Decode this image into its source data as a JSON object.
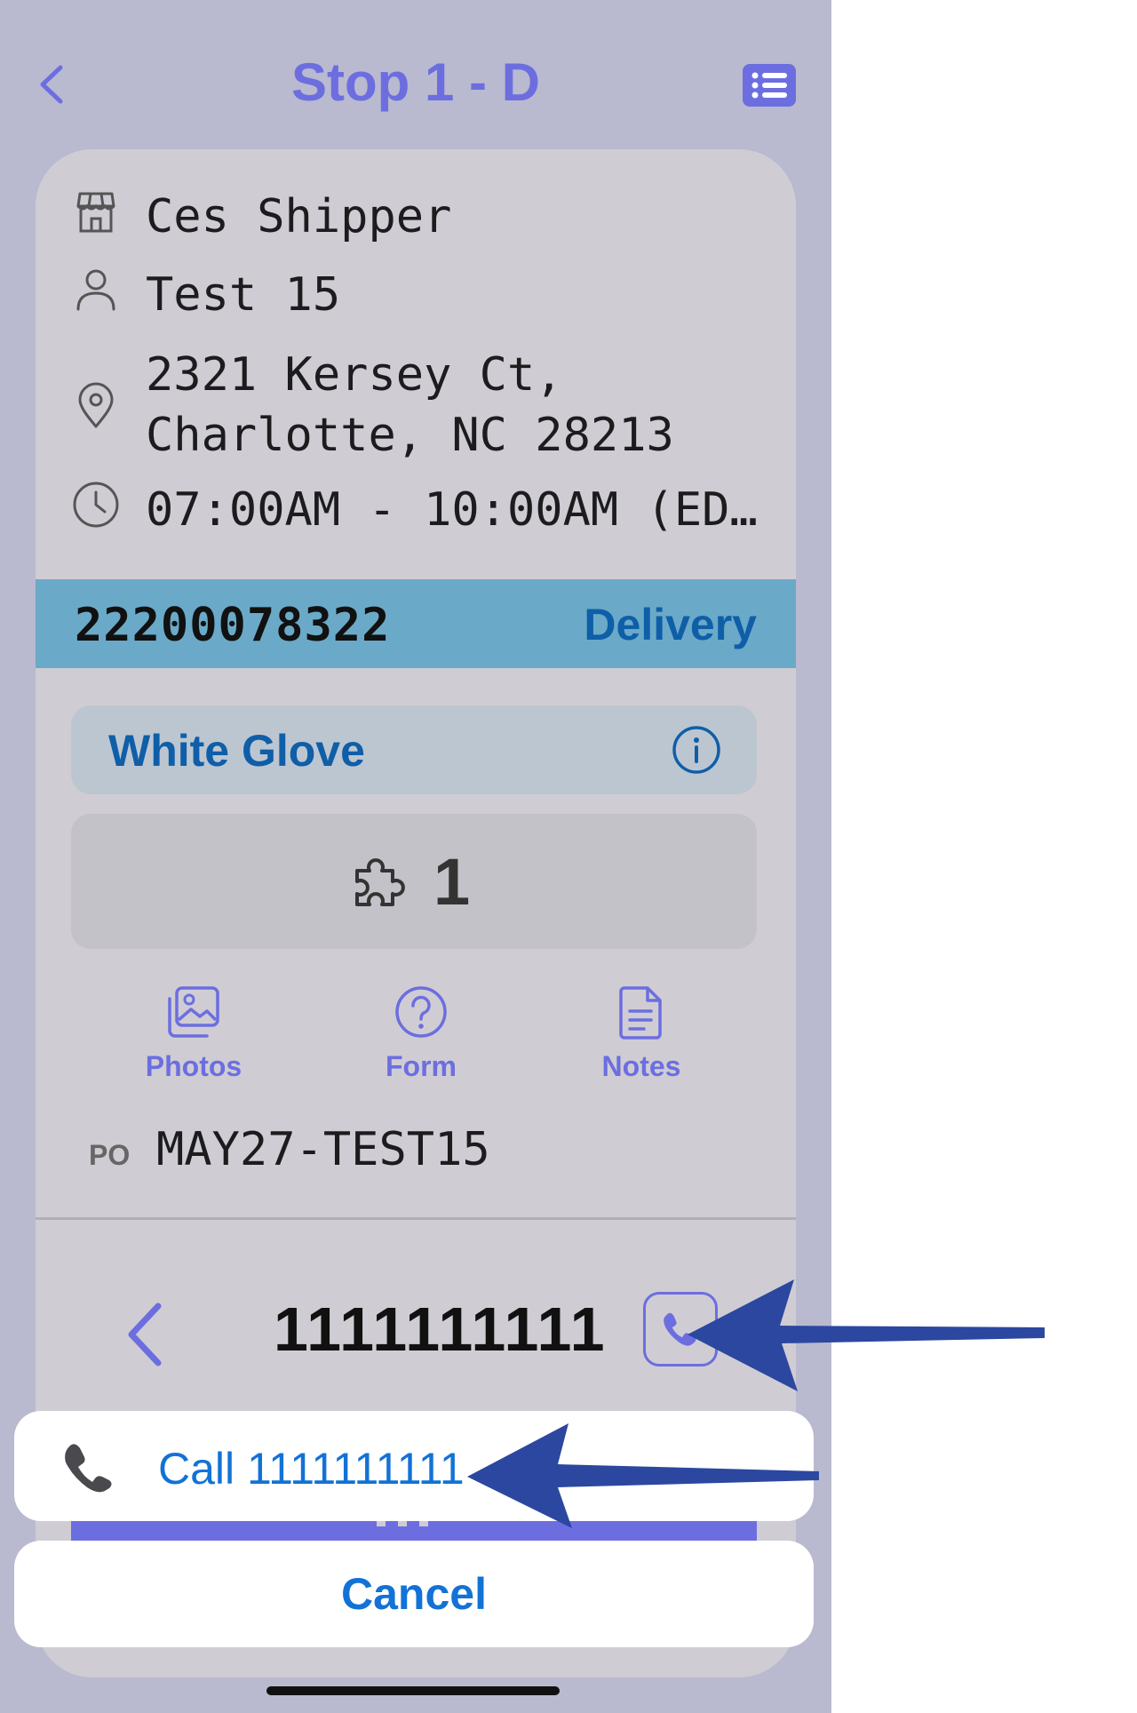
{
  "nav": {
    "title": "Stop 1 - D",
    "back_icon": "chevron-left-icon",
    "list_icon": "list-icon"
  },
  "stop": {
    "shipper": "Ces Shipper",
    "contact": "Test 15",
    "address": "2321 Kersey Ct,\nCharlotte, NC 28213",
    "time_window": "07:00AM - 10:00AM (ED…"
  },
  "order": {
    "number": "22200078322",
    "type": "Delivery"
  },
  "service": {
    "label": "White Glove",
    "icon": "info-icon"
  },
  "pieces": {
    "count": "1",
    "icon": "puzzle-icon"
  },
  "actions": [
    {
      "label": "Photos",
      "icon": "photos-icon"
    },
    {
      "label": "Form",
      "icon": "question-icon"
    },
    {
      "label": "Notes",
      "icon": "notes-icon"
    }
  ],
  "po": {
    "label": "PO",
    "value": "MAY27-TEST15"
  },
  "phone": {
    "number": "1111111111"
  },
  "sheet": {
    "call_label": "Call 1111111111",
    "cancel_label": "Cancel"
  },
  "colors": {
    "accent": "#6c6ee0",
    "band": "#6aaac8",
    "link_blue": "#1272d6",
    "annotation_arrow": "#2b47a0"
  }
}
